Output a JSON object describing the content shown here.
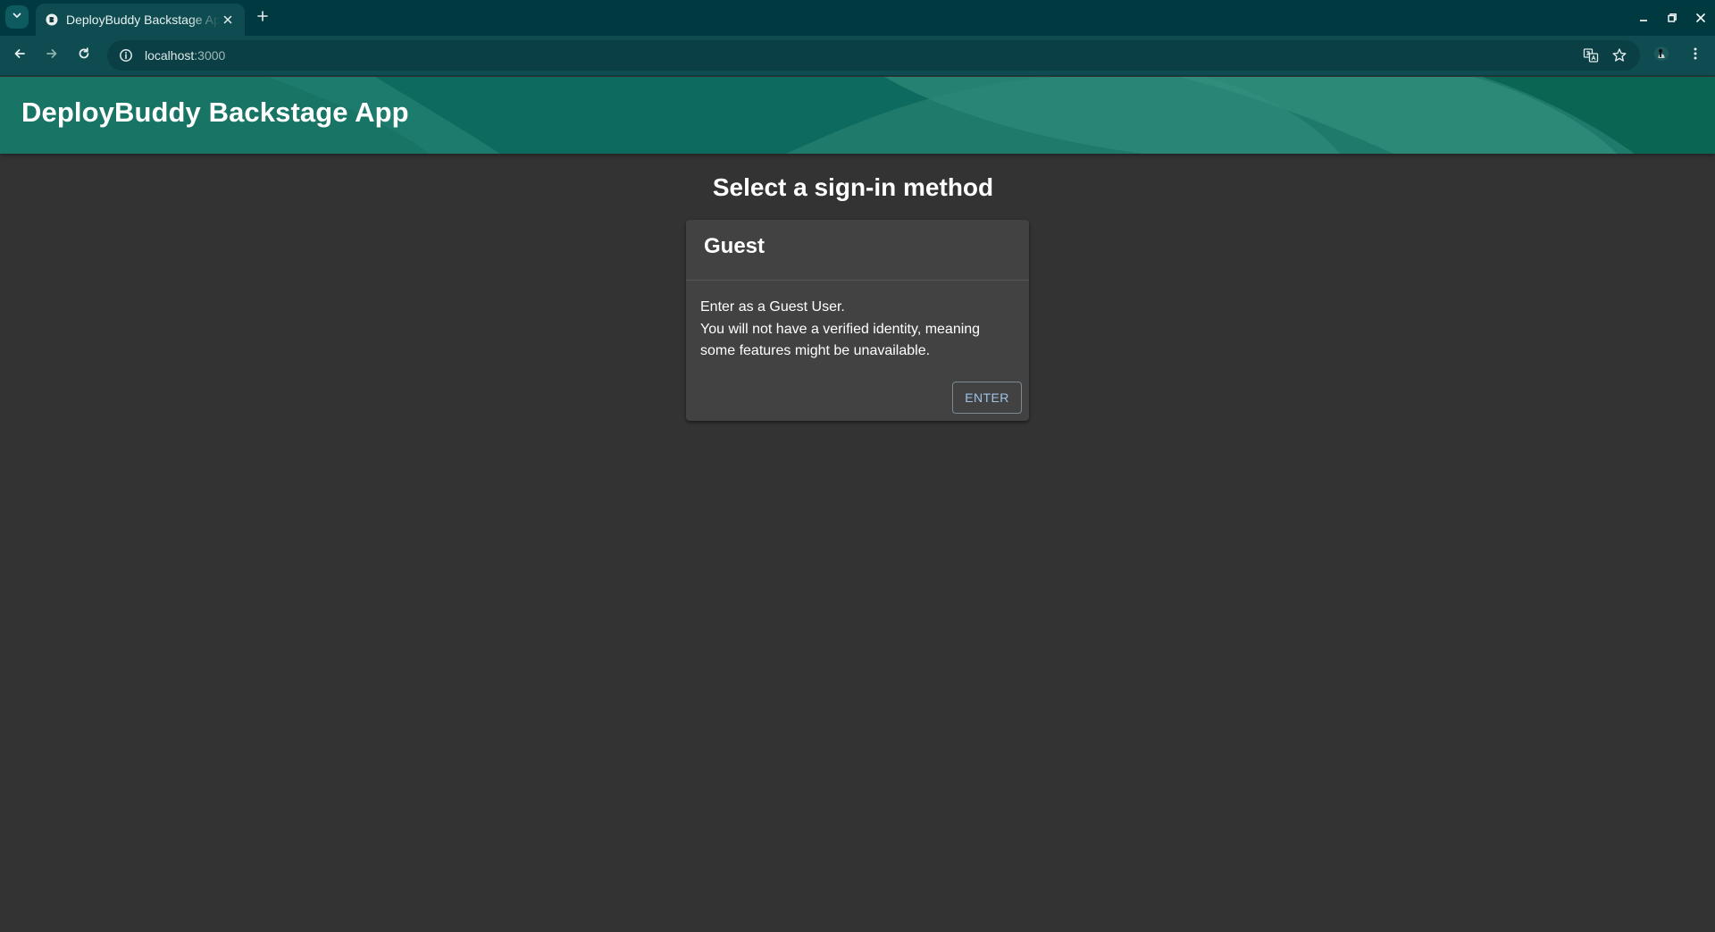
{
  "browser": {
    "tab_title": "DeployBuddy Backstage App",
    "url_host": "localhost",
    "url_port": ":3000"
  },
  "app": {
    "title": "DeployBuddy Backstage App",
    "colors": {
      "header": "#0f6b60",
      "background": "#333333",
      "card": "#424242",
      "button_text": "#9fc3e8"
    }
  },
  "signin": {
    "heading": "Select a sign-in method",
    "provider": {
      "title": "Guest",
      "lines": [
        "Enter as a Guest User.",
        "You will not have a verified identity, meaning",
        "some features might be unavailable."
      ],
      "button_label": "ENTER"
    }
  },
  "icons": {
    "tab_search": "chevron-down-icon",
    "favicon": "backstage-favicon",
    "tab_close": "close-icon",
    "new_tab": "plus-icon",
    "back": "arrow-left-icon",
    "forward": "arrow-right-icon",
    "reload": "reload-icon",
    "site_info": "info-icon",
    "translate": "translate-icon",
    "bookmark": "star-icon",
    "profile": "profile-icon",
    "menu": "kebab-menu-icon",
    "minimize": "minimize-icon",
    "restore": "restore-icon",
    "close_window": "close-icon"
  }
}
